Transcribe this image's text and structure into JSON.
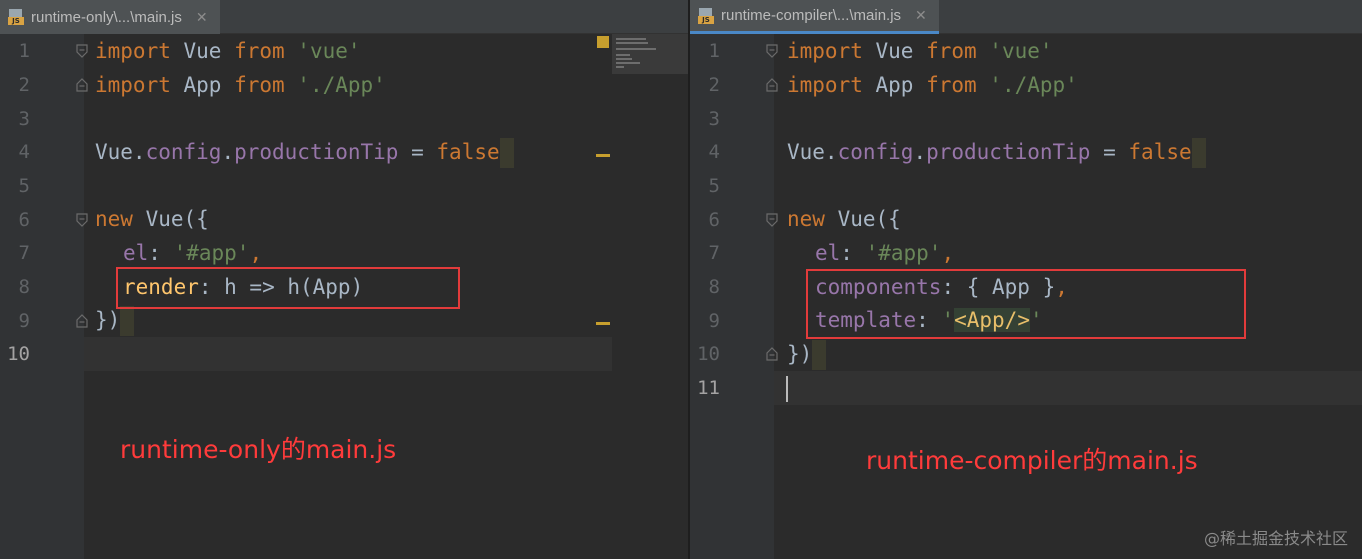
{
  "left": {
    "tab_title": "runtime-only\\...\\main.js",
    "file_icon_label": "JS",
    "line_numbers": [
      "1",
      "2",
      "3",
      "4",
      "5",
      "6",
      "7",
      "8",
      "9",
      "10"
    ],
    "line1": {
      "kw1": "import",
      "id": " Vue ",
      "kw2": "from",
      "str": " 'vue'"
    },
    "line2": {
      "kw1": "import",
      "id": " App ",
      "kw2": "from",
      "str": " './App'"
    },
    "line4": {
      "obj": "Vue.",
      "p1": "config",
      "dot": ".",
      "p2": "productionTip",
      "eq": " = ",
      "val": "false"
    },
    "line6": {
      "kw": "new",
      "rest": " Vue({"
    },
    "line7": {
      "key": "el",
      "colon": ": ",
      "val": "'#app'",
      "comma": ","
    },
    "line8": {
      "key": "render",
      "rest": ": h => h(App)"
    },
    "line9": {
      "text": "})"
    },
    "caption": "runtime-only的main.js"
  },
  "right": {
    "tab_title": "runtime-compiler\\...\\main.js",
    "file_icon_label": "JS",
    "line_numbers": [
      "1",
      "2",
      "3",
      "4",
      "5",
      "6",
      "7",
      "8",
      "9",
      "10",
      "11"
    ],
    "line1": {
      "kw1": "import",
      "id": " Vue ",
      "kw2": "from",
      "str": " 'vue'"
    },
    "line2": {
      "kw1": "import",
      "id": " App ",
      "kw2": "from",
      "str": " './App'"
    },
    "line4": {
      "obj": "Vue.",
      "p1": "config",
      "dot": ".",
      "p2": "productionTip",
      "eq": " = ",
      "val": "false"
    },
    "line6": {
      "kw": "new",
      "rest": " Vue({"
    },
    "line7": {
      "key": "el",
      "colon": ": ",
      "val": "'#app'",
      "comma": ","
    },
    "line8": {
      "key": "components",
      "rest": ": { App }",
      "comma": ","
    },
    "line9": {
      "key": "template",
      "colon": ": ",
      "q1": "'",
      "tag": "<App/>",
      "q2": "'"
    },
    "line10": {
      "text": "})"
    },
    "caption": "runtime-compiler的main.js"
  },
  "watermark": "@稀土掘金技术社区",
  "colors": {
    "keyword": "#cc7832",
    "string": "#6a8759",
    "property": "#9876aa",
    "function": "#ffc66d",
    "highlight_box": "#e23b3b",
    "caption": "#ff3b3b",
    "tab_accent": "#4a88c7"
  }
}
